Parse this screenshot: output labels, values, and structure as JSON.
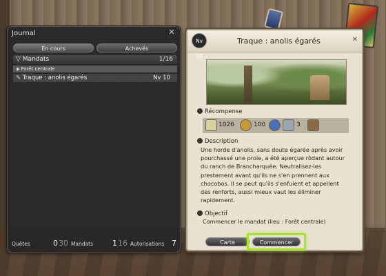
{
  "journal": {
    "title": "Journal",
    "tabs": [
      "En cours",
      "Achevés"
    ],
    "category": {
      "label": "Mandats",
      "count": "1/16"
    },
    "subcategory": "Forêt centrale",
    "entries": [
      {
        "label": "Traque : anolis égarés",
        "level": "Nv 10"
      }
    ],
    "footer": {
      "quetes_label": "Quêtes",
      "quetes_value": "0",
      "quetes_max": "30",
      "mandats_label": "Mandats",
      "mandats_value": "1",
      "mandats_max": "16",
      "autorisations_label": "Autorisations",
      "autorisations_value": "7"
    }
  },
  "detail": {
    "level_badge": "Nv 10",
    "title": "Traque : anolis égarés",
    "rewards_label": "Récompense",
    "rewards": {
      "exp": "1026",
      "gil": "100",
      "seals": "3"
    },
    "description_label": "Description",
    "description": "Une horde d'anolis, sans doute égarée après avoir pourchassé une proie, a été aperçue rôdant autour du ranch de Brancharquée. Neutralisez-les prestement avant qu'ils ne s'en prennent aux chocobos. Il se peut qu'ils s'enfuient et appellent des renforts, aussi mieux vaut les éliminer rapidement.",
    "objective_label": "Objectif",
    "objective": "Commencer le mandat (lieu : Forêt centrale)",
    "buttons": {
      "map": "Carte",
      "start": "Commencer"
    }
  },
  "colors": {
    "highlight": "#a6e22e",
    "panel_dark": "#262626",
    "panel_light": "#e9e2d2"
  }
}
